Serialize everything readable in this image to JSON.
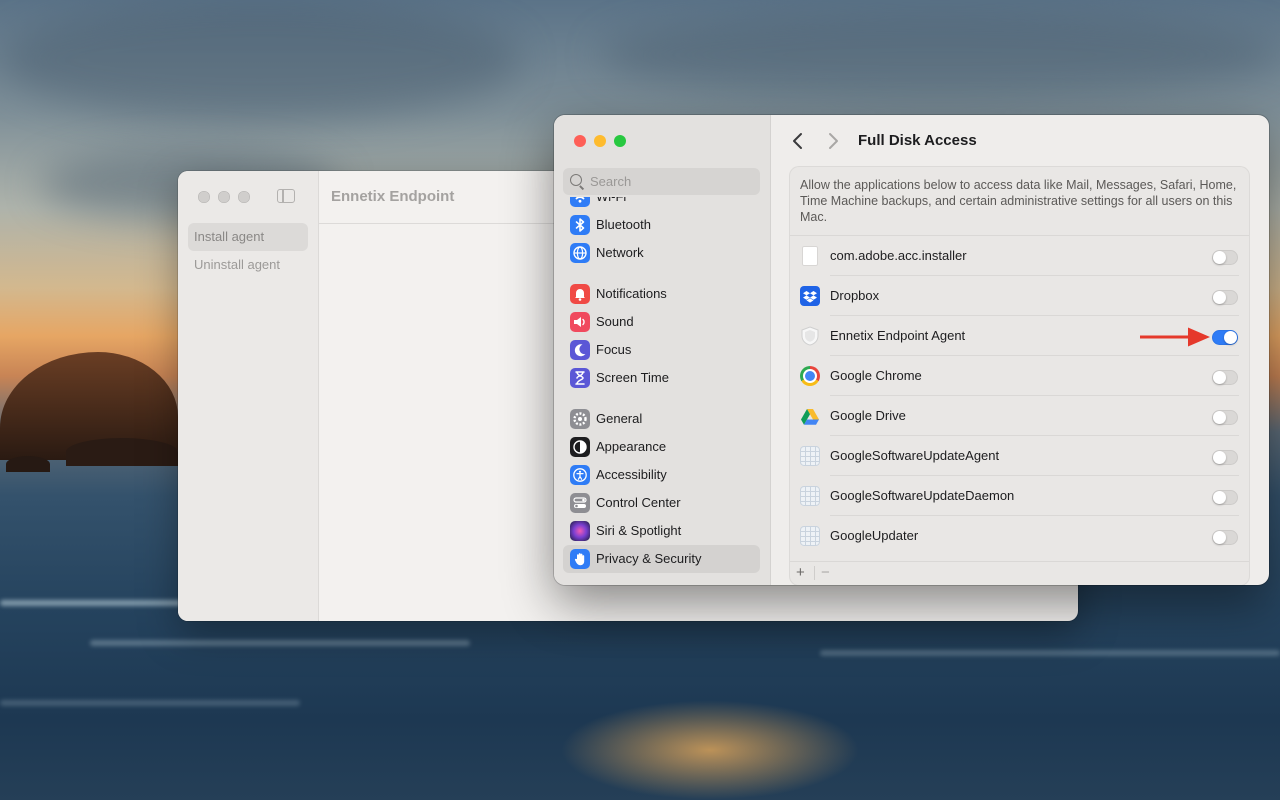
{
  "back_window": {
    "title": "Ennetix Endpoint",
    "sidebar_items": [
      "Install agent",
      "Uninstall agent"
    ]
  },
  "settings": {
    "search_placeholder": "Search",
    "title": "Full Disk Access",
    "description": "Allow the applications below to access data like Mail, Messages, Safari, Home, Time Machine backups, and certain administrative settings for all users on this Mac.",
    "nav": [
      {
        "label": "Wi-Fi",
        "icon": "wifi-icon",
        "color": "#2f7cf6"
      },
      {
        "label": "Bluetooth",
        "icon": "bluetooth-icon",
        "color": "#2f7cf6"
      },
      {
        "label": "Network",
        "icon": "globe-icon",
        "color": "#2f7cf6"
      },
      {
        "label": "Notifications",
        "icon": "bell-icon",
        "color": "#f04a45"
      },
      {
        "label": "Sound",
        "icon": "speaker-icon",
        "color": "#f04a5e"
      },
      {
        "label": "Focus",
        "icon": "moon-icon",
        "color": "#5b57d6"
      },
      {
        "label": "Screen Time",
        "icon": "hourglass-icon",
        "color": "#5b57d6"
      },
      {
        "label": "General",
        "icon": "gear-icon",
        "color": "#8e8e93"
      },
      {
        "label": "Appearance",
        "icon": "appearance-icon",
        "color": "#1d1d1f"
      },
      {
        "label": "Accessibility",
        "icon": "accessibility-icon",
        "color": "#2f7cf6"
      },
      {
        "label": "Control Center",
        "icon": "control-center-icon",
        "color": "#8e8e93"
      },
      {
        "label": "Siri & Spotlight",
        "icon": "siri-icon",
        "color": "#7a3fd1"
      },
      {
        "label": "Privacy & Security",
        "icon": "hand-icon",
        "color": "#2f7cf6",
        "selected": true
      }
    ],
    "apps": [
      {
        "name": "com.adobe.acc.installer",
        "icon": "file-icon",
        "enabled": false
      },
      {
        "name": "Dropbox",
        "icon": "dropbox-icon",
        "enabled": false
      },
      {
        "name": "Ennetix Endpoint Agent",
        "icon": "shield-icon",
        "enabled": true
      },
      {
        "name": "Google Chrome",
        "icon": "chrome-icon",
        "enabled": false
      },
      {
        "name": "Google Drive",
        "icon": "google-drive-icon",
        "enabled": false
      },
      {
        "name": "GoogleSoftwareUpdateAgent",
        "icon": "grid-app-icon",
        "enabled": false
      },
      {
        "name": "GoogleSoftwareUpdateDaemon",
        "icon": "grid-app-icon",
        "enabled": false
      },
      {
        "name": "GoogleUpdater",
        "icon": "grid-app-icon",
        "enabled": false
      }
    ],
    "add_label": "+",
    "remove_label": "−",
    "arrow_color": "#e5392b"
  }
}
